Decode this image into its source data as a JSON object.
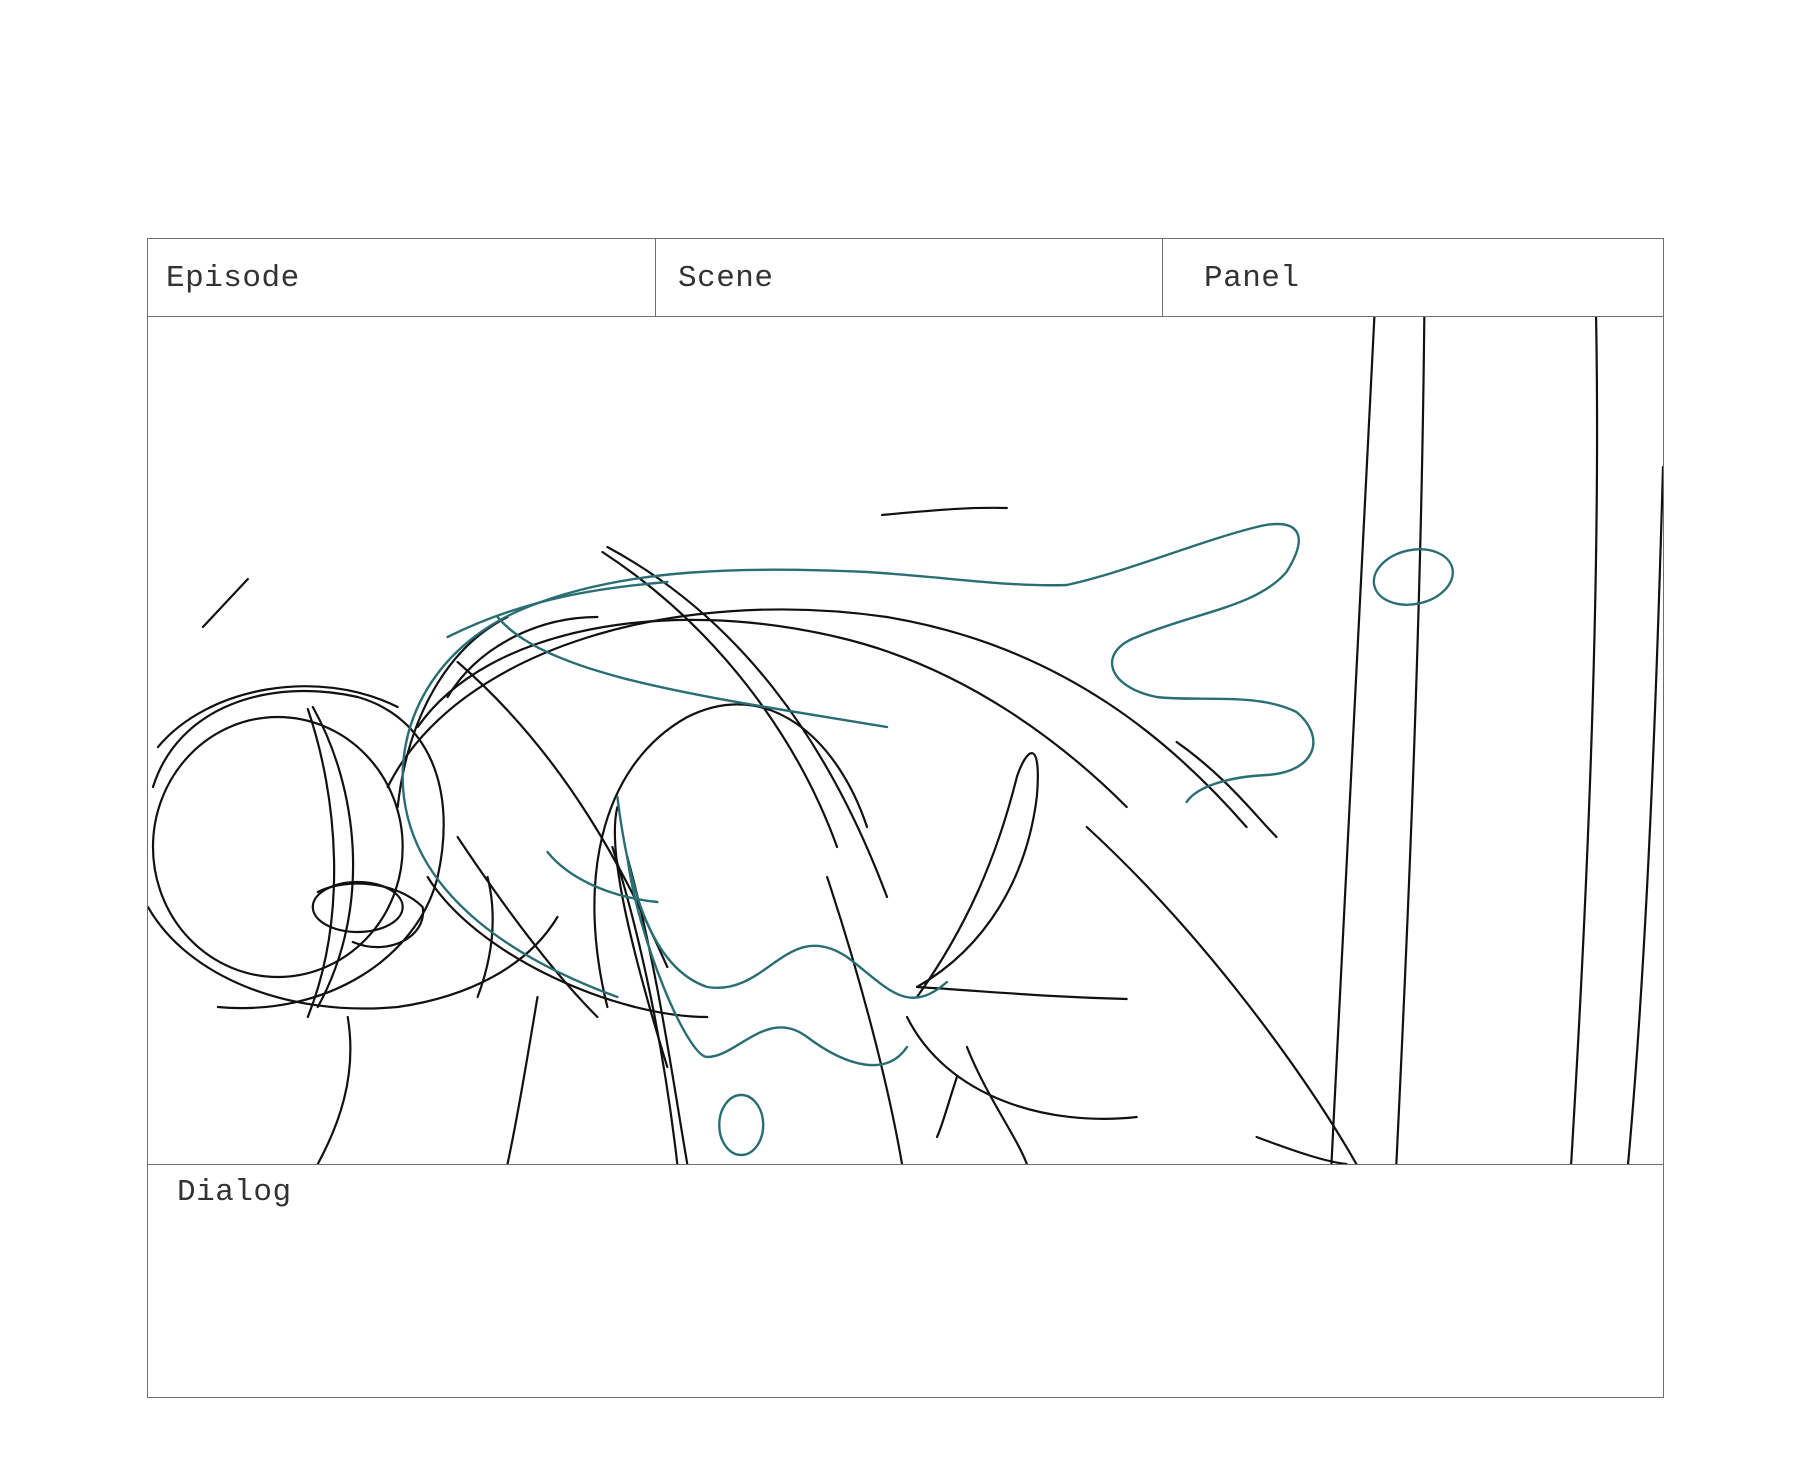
{
  "storyboard": {
    "header": {
      "episode_label": "Episode",
      "scene_label": "Scene",
      "panel_label": "Panel"
    },
    "dialog_label": "Dialog",
    "sketch": {
      "line_color": "#111111",
      "accent_color": "#2a6e73"
    }
  }
}
